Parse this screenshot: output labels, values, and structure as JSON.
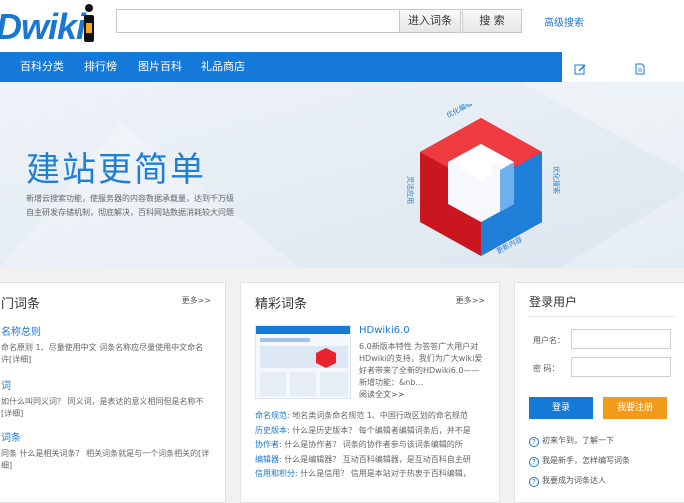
{
  "header": {
    "logo_text": "Dwiki",
    "search_placeholder": "",
    "enter_button": "进入词条",
    "search_button": "搜 索",
    "advanced_search": "高级搜索"
  },
  "nav": {
    "items": [
      "百科分类",
      "排行榜",
      "图片百科",
      "礼品商店"
    ]
  },
  "banner": {
    "title": "建站更简单",
    "desc_line1": "新增云搜索功能，使服务器的内容数据承载量，达到千万级",
    "desc_line2": "自主研发存储机制，彻底解决，百科网站数据消耗较大问题",
    "cube_labels": [
      "优化编辑",
      "灵活应用",
      "优化搜索",
      "更新内容"
    ]
  },
  "left_panel": {
    "title": "门词条",
    "more": "更多>>",
    "terms": [
      {
        "title": "名称总则",
        "desc": "命名原则 1、尽量使用中文 词条名称应尽量使用中文命名 许[详细]"
      },
      {
        "title": "词",
        "desc": "如什么叫同义词？ 同义词，是表达的意义相同但是名称不[详细]"
      },
      {
        "title": "词条",
        "desc": "同条 什么是相关词条？ 相关词条就是与一个词条相关的[详细]"
      }
    ]
  },
  "mid_panel": {
    "title": "精彩词条",
    "more": "更多>>",
    "feature_title": "HDwiki6.0",
    "feature_desc": "6.0新版本特性 为答答广大用户对HDwiki的支持，我们为广大wiki爱好者带来了全新的HDwiki6.0——  新增功能：&nb...",
    "feature_more": "阅读全文>>",
    "list": [
      {
        "k": "命名规范",
        "v": ": 地名类词条命名规范 1、中国行政区划的命名规范"
      },
      {
        "k": "历史版本",
        "v": ": 什么是历史版本？ 每个编辑者编辑词条后，并不是"
      },
      {
        "k": "协作者",
        "v": ": 什么是协作者？ 词条的协作者参与该词条编辑的所"
      },
      {
        "k": "编辑器",
        "v": ": 什么是编辑器？ 互动百科编辑器，是互动百科自主研"
      },
      {
        "k": "信用和积分",
        "v": ": 什么是信用？ 信用是本站对于热衷于百科编辑，"
      }
    ]
  },
  "right_panel": {
    "title": "登录用户",
    "username_label": "用户名：",
    "password_label": "密  码：",
    "login_button": "登录",
    "register_button": "我要注册",
    "help": [
      "初来乍到，了解一下",
      "我是新手，怎样编写词条",
      "我要成为词条达人"
    ]
  },
  "colors": {
    "brand_blue": "#1479d8",
    "register_orange": "#f29b1a",
    "cube_red": "#e8232c"
  }
}
